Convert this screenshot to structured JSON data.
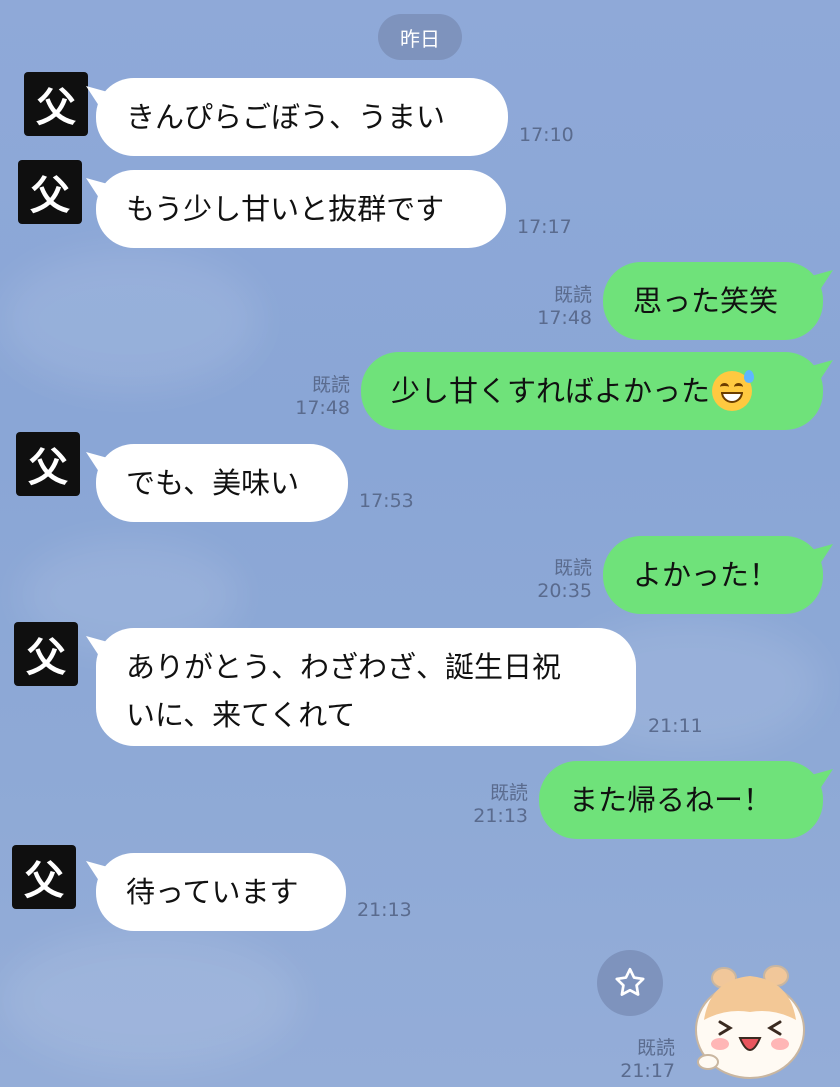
{
  "date_separator": "昨日",
  "avatar_label": "父",
  "messages": [
    {
      "text": "きんぴらごぼう、うまい",
      "time": "17:10"
    },
    {
      "text": "もう少し甘いと抜群です",
      "time": "17:17"
    },
    {
      "text": "思った笑笑",
      "read": "既読",
      "time": "17:48"
    },
    {
      "text": "少し甘くすればよかった",
      "emoji": "sweat-smile-emoji",
      "read": "既読",
      "time": "17:48"
    },
    {
      "text": "でも、美味い",
      "time": "17:53"
    },
    {
      "text": "よかった！",
      "read": "既読",
      "time": "20:35"
    },
    {
      "line1": "ありがとう、わざわざ、誕生日祝",
      "line2": "いに、来てくれて",
      "time": "21:11"
    },
    {
      "text": "また帰るねー！",
      "read": "既読",
      "time": "21:13"
    },
    {
      "text": "待っています",
      "time": "21:13"
    },
    {
      "type": "sticker",
      "sticker": "hamster-sticker",
      "read": "既読",
      "time": "21:17"
    }
  ],
  "colors": {
    "background": "#8aa6d6",
    "incoming_bubble": "#ffffff",
    "outgoing_bubble": "#6fe27a",
    "pill": "#7e93bd",
    "meta_text": "#5a6b8e"
  },
  "icons": [
    "star-icon",
    "sweat-smile-emoji",
    "hamster-sticker"
  ]
}
